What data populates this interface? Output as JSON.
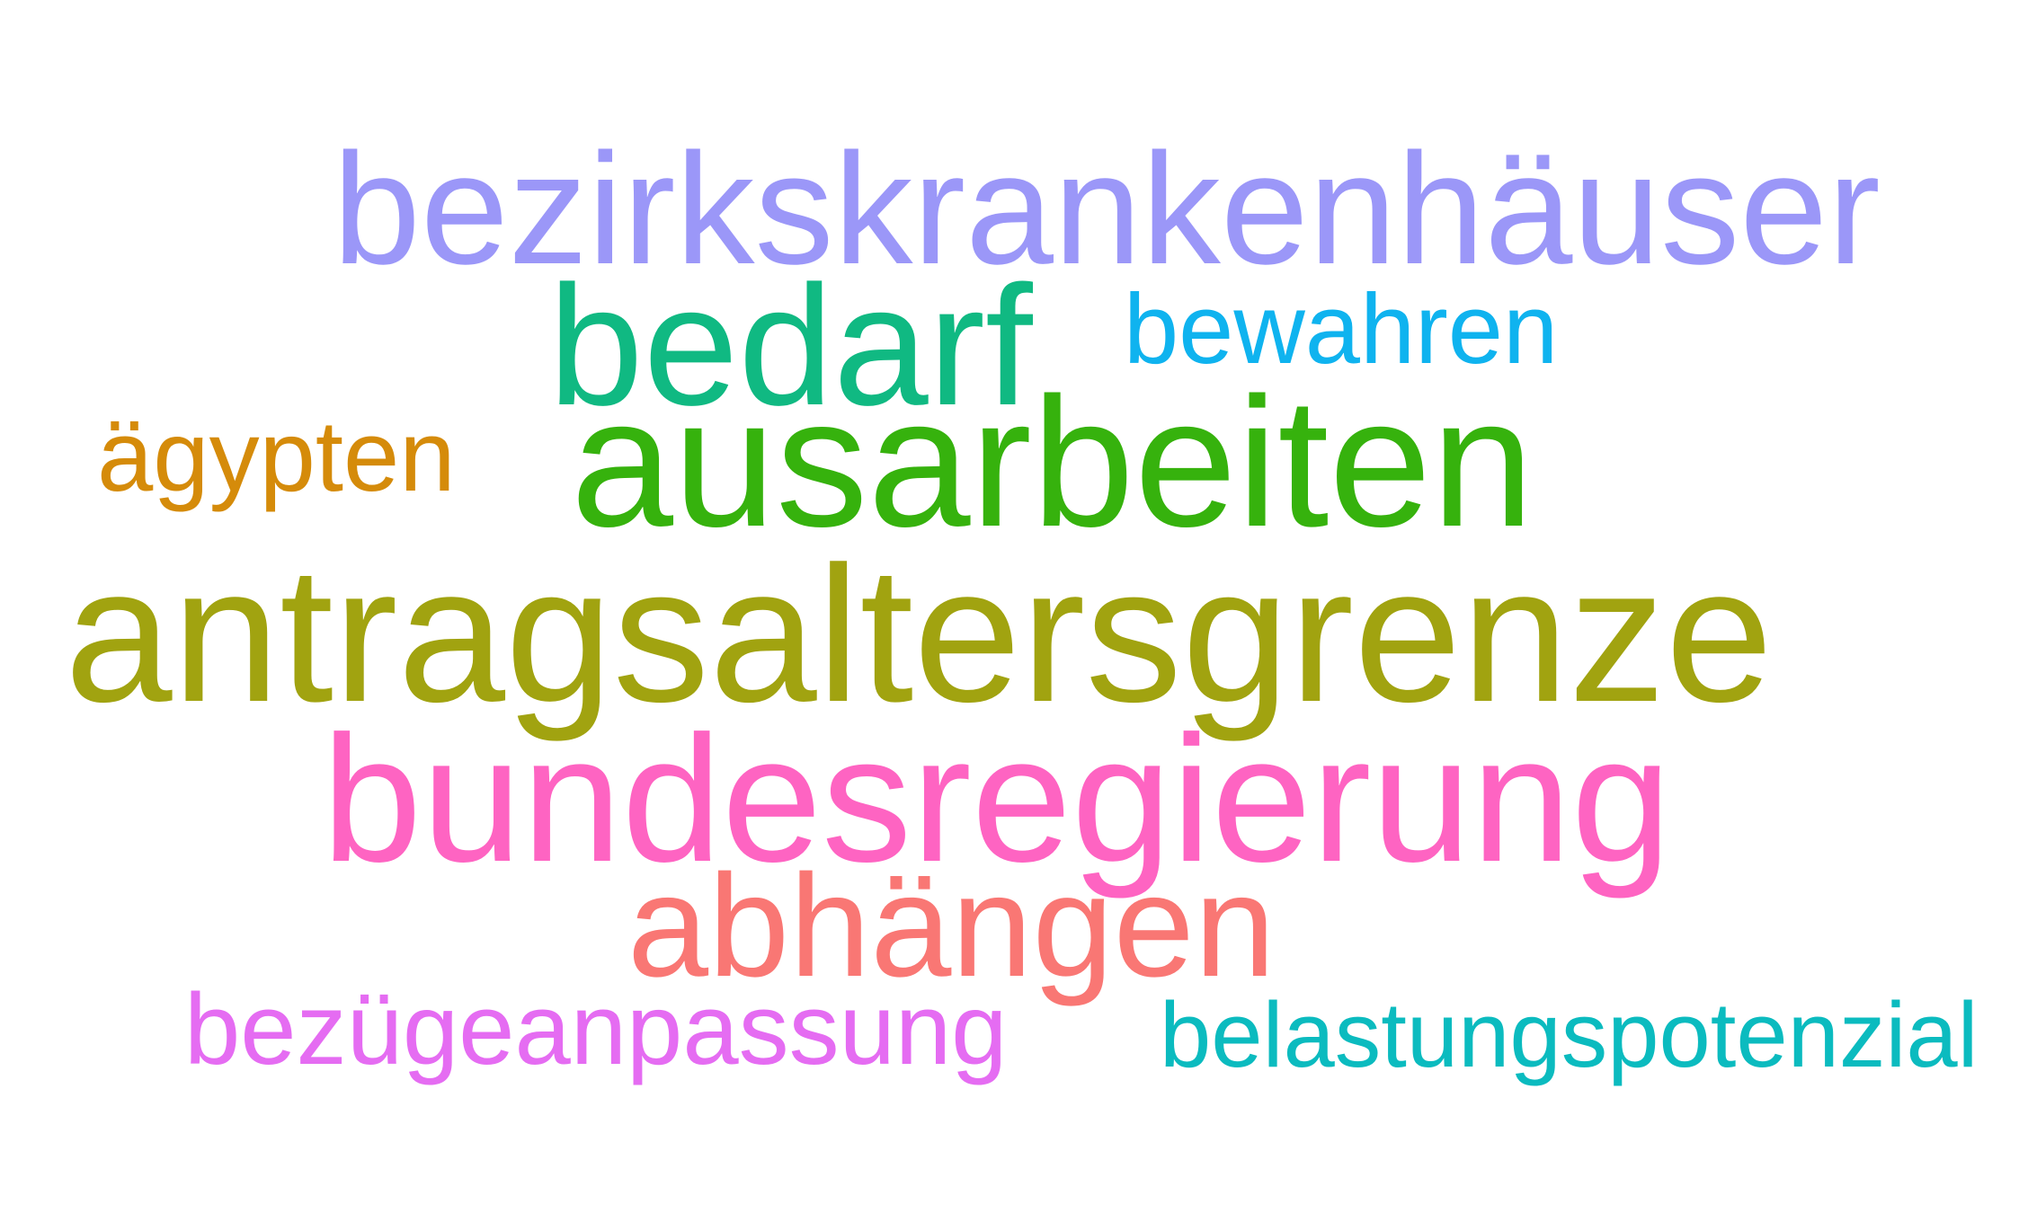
{
  "words": [
    {
      "id": "w-bezirkskrankenhaeuser",
      "text": "bezirkskrankenhäuser",
      "color": "#9b97f8"
    },
    {
      "id": "w-bedarf",
      "text": "bedarf",
      "color": "#10b982"
    },
    {
      "id": "w-bewahren",
      "text": "bewahren",
      "color": "#0fb3ef"
    },
    {
      "id": "w-aegypten",
      "text": "ägypten",
      "color": "#d58b0a"
    },
    {
      "id": "w-ausarbeiten",
      "text": "ausarbeiten",
      "color": "#36b20d"
    },
    {
      "id": "w-antragsaltersgrenze",
      "text": "antragsaltersgrenze",
      "color": "#a1a310"
    },
    {
      "id": "w-bundesregierung",
      "text": "bundesregierung",
      "color": "#fe64c2"
    },
    {
      "id": "w-abhaengen",
      "text": "abhängen",
      "color": "#f97774"
    },
    {
      "id": "w-bezuegeanpassung",
      "text": "bezügeanpassung",
      "color": "#e56cf2"
    },
    {
      "id": "w-belastungspotenzial",
      "text": "belastungspotenzial",
      "color": "#0bbbbf"
    }
  ]
}
